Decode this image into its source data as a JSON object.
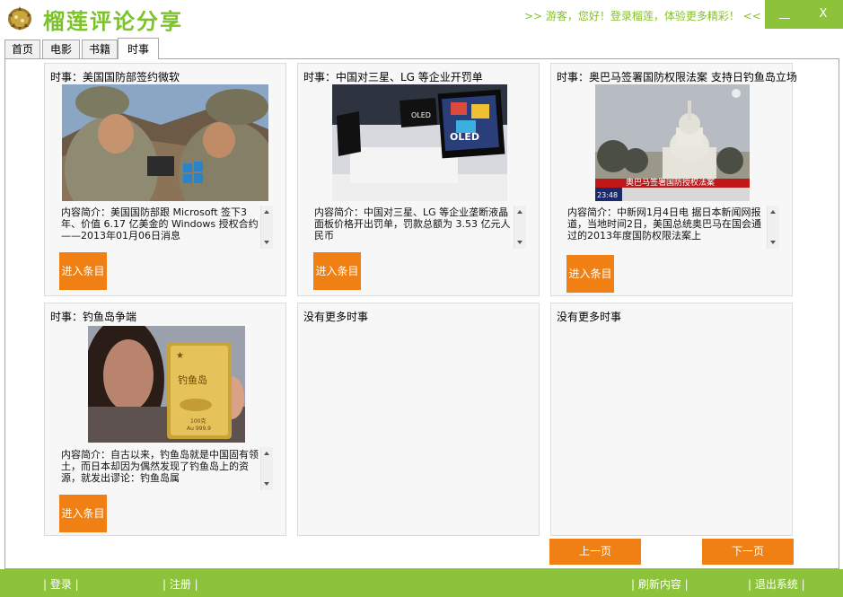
{
  "app": {
    "title": "榴莲评论分享",
    "greeting": ">> 游客，您好！登录榴莲，体验更多精彩！ <<",
    "close_label": "X"
  },
  "tabs": [
    {
      "label": "首页"
    },
    {
      "label": "电影"
    },
    {
      "label": "书籍"
    },
    {
      "label": "时事"
    }
  ],
  "cards": [
    {
      "title": "时事：美国国防部签约微软",
      "desc": "内容简介：美国国防部跟 Microsoft 签下3 年、价值 6.17 亿美金的 Windows 授权合约——2013年01月06日消息",
      "button": "进入条目"
    },
    {
      "title": "时事：中国对三星、LG 等企业开罚单",
      "desc": "内容简介：中国对三星、LG 等企业垄断液晶面板价格开出罚单，罚款总额为 3.53 亿元人民币",
      "button": "进入条目",
      "img_text": "OLED"
    },
    {
      "title": "时事：奥巴马签署国防权限法案 支持日钓鱼岛立场",
      "desc": "内容简介：中新网1月4日电 据日本新闻网报道，当地时间2日，美国总统奥巴马在国会通过的2013年度国防权限法案上",
      "button": "进入条目",
      "img_caption": "奥巴马签署国防授权法案",
      "img_ticker": "23:48"
    },
    {
      "title": "时事：钓鱼岛争端",
      "desc": "内容简介：自古以来，钓鱼岛就是中国固有领土，而日本却因为偶然发现了钓鱼岛上的资源，就发出谬论：钓鱼岛属",
      "button": "进入条目",
      "img_text": "钓鱼岛",
      "img_sub": "100克",
      "img_sub2": "Au 999.9"
    },
    {
      "title": "没有更多时事"
    },
    {
      "title": "没有更多时事"
    }
  ],
  "pager": {
    "prev": "上一页",
    "next": "下一页"
  },
  "bottom": {
    "login": "| 登录 |",
    "register": "| 注册 |",
    "refresh": "| 刷新内容 |",
    "exit": "| 退出系统 |"
  },
  "colors": {
    "accent_green": "#8cc33a",
    "button_orange": "#f08014"
  }
}
